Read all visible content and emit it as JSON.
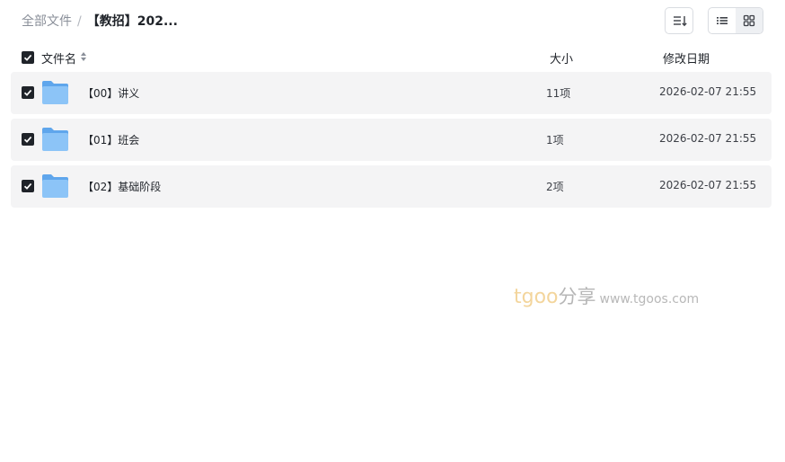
{
  "breadcrumb": {
    "root": "全部文件",
    "separator": "/",
    "current": "【教招】202..."
  },
  "toolbar": {
    "sort_icon": "sort-lines-icon",
    "list_view_icon": "list-view-icon",
    "grid_view_icon": "grid-view-icon"
  },
  "table": {
    "columns": {
      "name": "文件名",
      "size": "大小",
      "date": "修改日期"
    },
    "rows": [
      {
        "name": "【00】讲义",
        "size": "11项",
        "date": "2026-02-07 21:55"
      },
      {
        "name": "【01】班会",
        "size": "1项",
        "date": "2026-02-07 21:55"
      },
      {
        "name": "【02】基础阶段",
        "size": "2项",
        "date": "2026-02-07 21:55"
      }
    ]
  },
  "watermark": {
    "brand": "tgoo",
    "share": "分享",
    "url": "www.tgoos.com"
  },
  "colors": {
    "row_bg": "#f4f4f5",
    "checkbox": "#1f2329",
    "folder": "#7ab8f5"
  }
}
